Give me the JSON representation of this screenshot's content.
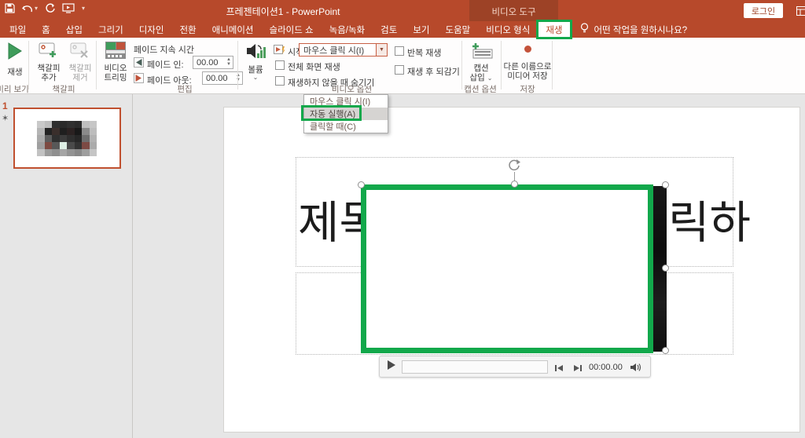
{
  "colors": {
    "titlebar": "#b7492b",
    "contextual_tab_bg": "#9d4226",
    "annotation_green": "#12a84b",
    "thumbnail_border": "#c0502f",
    "active_tab_text": "#b7492b"
  },
  "titlebar": {
    "title": "프레젠테이션1 - PowerPoint",
    "contextual_group": "비디오 도구",
    "login": "로그인"
  },
  "tabs": {
    "file": "파일",
    "home": "홈",
    "insert": "삽입",
    "draw": "그리기",
    "design": "디자인",
    "transitions": "전환",
    "animations": "애니메이션",
    "slideshow": "슬라이드 쇼",
    "record": "녹음/녹화",
    "review": "검토",
    "view": "보기",
    "help": "도움말",
    "video_format": "비디오 형식",
    "playback": "재생",
    "tell_me": "어떤 작업을 원하시나요?"
  },
  "ribbon": {
    "preview": {
      "play": "재생",
      "group": "미리 보기"
    },
    "bookmarks": {
      "add_l1": "책갈피",
      "add_l2": "추가",
      "remove_l1": "책갈피",
      "remove_l2": "제거",
      "group": "책갈피"
    },
    "editing": {
      "trim_l1": "비디오",
      "trim_l2": "트리밍",
      "fade_header": "페이드 지속 시간",
      "fade_in": "페이드 인:",
      "fade_in_value": "00.00",
      "fade_out": "페이드 아웃:",
      "fade_out_value": "00.00",
      "group": "편집"
    },
    "video_options": {
      "volume": "볼륨",
      "start_label": "시작:",
      "start_value": "마우스 클릭 시(I)",
      "full_screen": "전체 화면 재생",
      "hide_while_not_playing": "재생하지 않을 때 숨기기",
      "loop": "반복 재생",
      "rewind": "재생 후 되감기",
      "group": "비디오 옵션",
      "menu": [
        "마우스 클릭 시(I)",
        "자동 실행(A)",
        "클릭할 때(C)"
      ]
    },
    "caption": {
      "l1": "캡션",
      "l2": "삽입",
      "group": "캡션 옵션"
    },
    "save_media": {
      "l1": "다른 이름으로",
      "l2": "미디어 저장",
      "group": "저장"
    }
  },
  "slidepanel": {
    "slide_number": "1",
    "animation_indicator": "✶"
  },
  "thumbnail": {
    "mosaic": [
      [
        "#c9c9c9",
        "#bdbdbd",
        "#2e2e2e",
        "#2a2a2a",
        "#303030",
        "#2b2b2b",
        "#bfbfbf",
        "#c6c6c6"
      ],
      [
        "#b5b5b5",
        "#232323",
        "#3a2f2c",
        "#1f1f1f",
        "#2b2222",
        "#191919",
        "#8a8a8a",
        "#bdbdbd"
      ],
      [
        "#aaaaaa",
        "#5c5c5c",
        "#303030",
        "#3c3c3c",
        "#2f2f2f",
        "#272727",
        "#6e6e6e",
        "#b3b3b3"
      ],
      [
        "#9f9f9f",
        "#7d4a42",
        "#585858",
        "#dff0e6",
        "#4a4a4a",
        "#333333",
        "#7c4a44",
        "#ababab"
      ],
      [
        "#c2c2c2",
        "#9b9b9b",
        "#8f8f8f",
        "#a5a5a5",
        "#939393",
        "#888888",
        "#9e9e9e",
        "#c5c5c5"
      ]
    ]
  },
  "slide": {
    "title_fragment_left": "제목",
    "title_fragment_right": "릭하"
  },
  "media_bar": {
    "time": "00:00.00"
  }
}
